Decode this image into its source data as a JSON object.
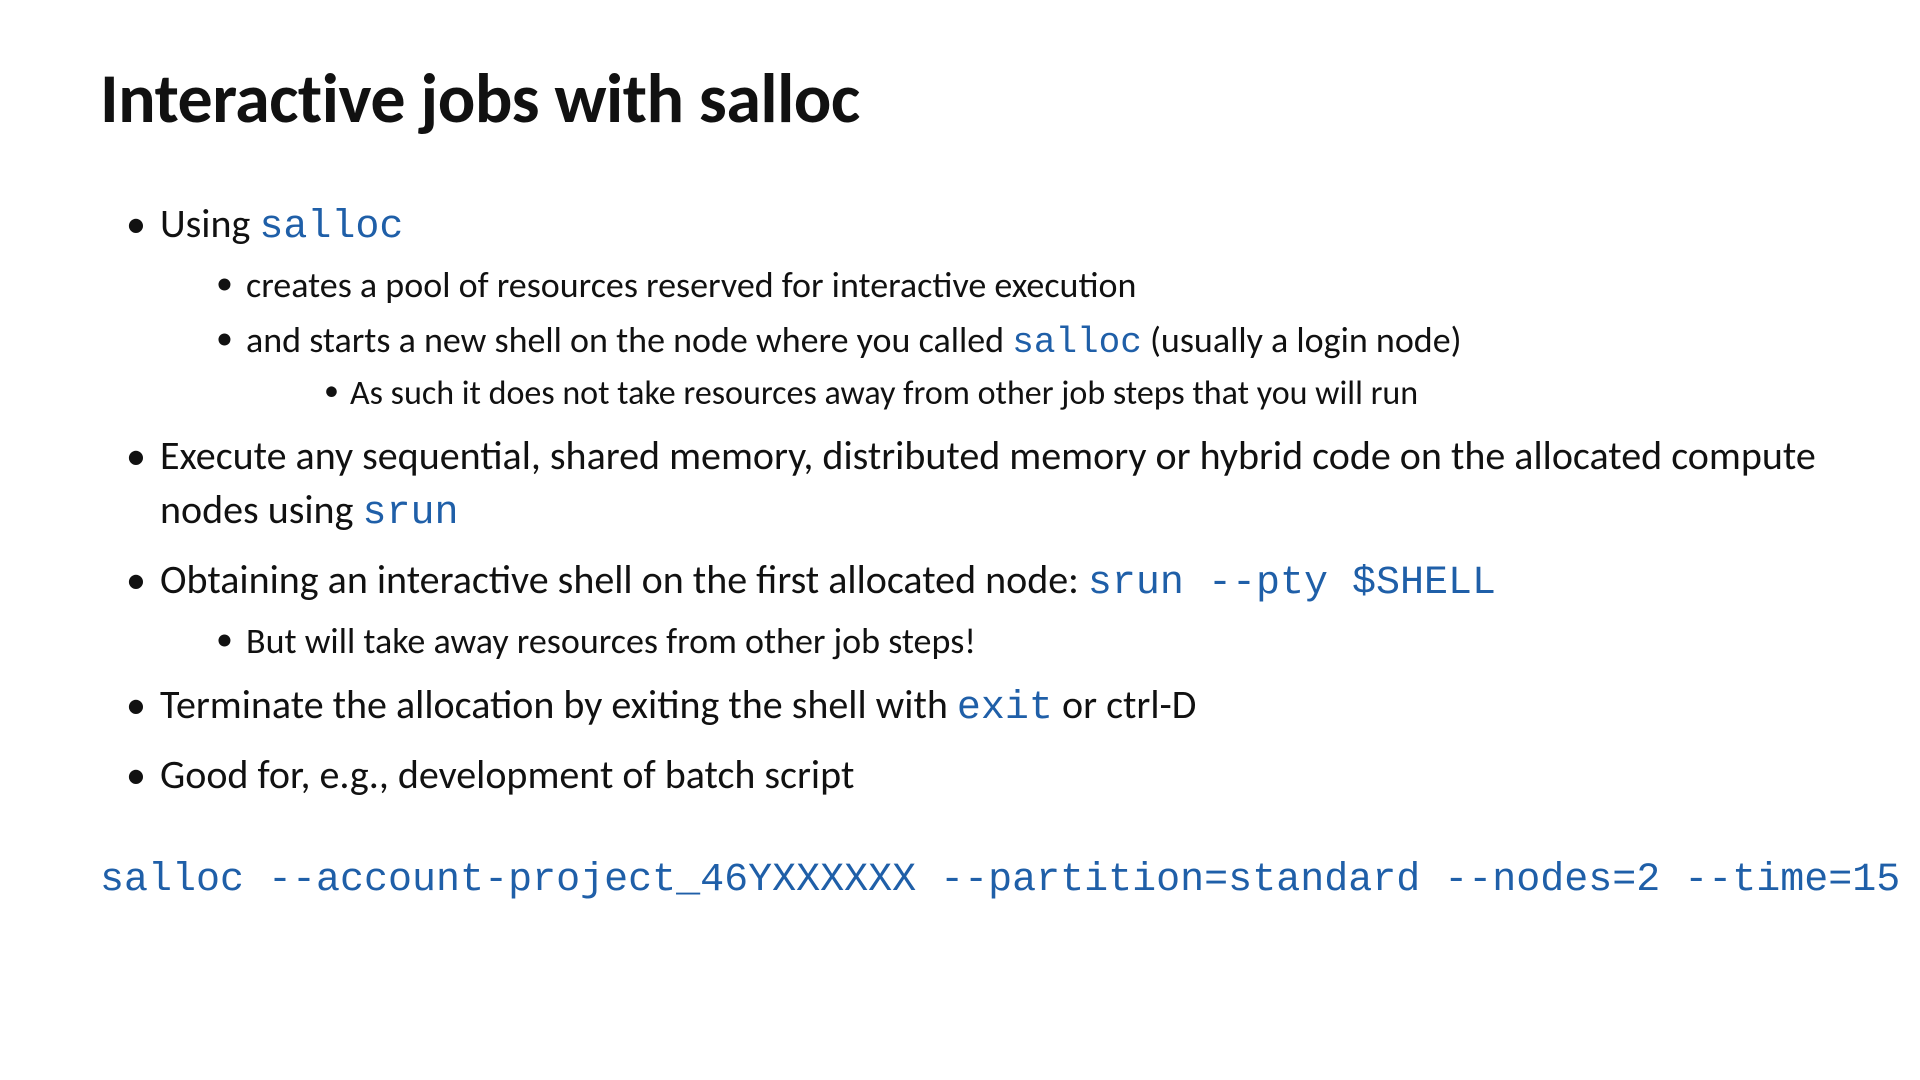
{
  "title": "Interactive jobs with salloc",
  "codes": {
    "salloc": "salloc",
    "srun": "srun",
    "srun_pty": "srun --pty $SHELL",
    "exit": "exit"
  },
  "bullets": {
    "b1_prefix": "Using ",
    "b1_sub1": "creates a pool of resources reserved for interactive execution",
    "b1_sub2_prefix": "and starts a new shell on the node where you called ",
    "b1_sub2_suffix": " (usually a login node)",
    "b1_sub2_sub1": "As such it does not take resources away from other job steps that you will run",
    "b2_prefix": "Execute any sequential, shared memory, distributed memory or hybrid code on the allocated compute nodes using ",
    "b3_prefix": "Obtaining an interactive shell on the first allocated node: ",
    "b3_sub1": "But will take away resources from other job steps!",
    "b4_prefix": "Terminate the allocation by exiting the shell with ",
    "b4_suffix": " or ctrl-D",
    "b5": "Good for, e.g., development of batch script"
  },
  "command": "salloc --account-project_46YXXXXXX --partition=standard --nodes=2 --time=15"
}
